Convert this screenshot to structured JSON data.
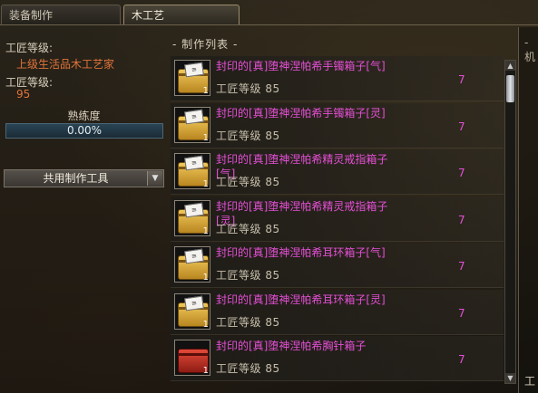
{
  "tabs": [
    {
      "label": "装备制作",
      "active": false
    },
    {
      "label": "木工艺",
      "active": true
    }
  ],
  "left": {
    "craft_level_label": "工匠等级:",
    "craft_title": "上级生活品木工艺家",
    "craft_level_label2": "工匠等级:",
    "craft_level_value": "95",
    "proficiency_label": "熟练度",
    "proficiency_text": "0.00%",
    "proficiency_value": 0,
    "tool_select": "共用制作工具"
  },
  "section": {
    "title": "- 制作列表 -",
    "right_title": "- 机"
  },
  "items": [
    {
      "name": "封印的[真]堕神涅帕希手镯箱子[气]",
      "level": "工匠等级 85",
      "count": "1",
      "qty": "7",
      "icon": "gold-box-icon"
    },
    {
      "name": "封印的[真]堕神涅帕希手镯箱子[灵]",
      "level": "工匠等级 85",
      "count": "1",
      "qty": "7",
      "icon": "gold-box-icon"
    },
    {
      "name": "封印的[真]堕神涅帕希精灵戒指箱子[气]",
      "level": "工匠等级 85",
      "count": "1",
      "qty": "7",
      "icon": "gold-box-icon"
    },
    {
      "name": "封印的[真]堕神涅帕希精灵戒指箱子[灵]",
      "level": "工匠等级 85",
      "count": "1",
      "qty": "7",
      "icon": "gold-box-icon"
    },
    {
      "name": "封印的[真]堕神涅帕希耳环箱子[气]",
      "level": "工匠等级 85",
      "count": "1",
      "qty": "7",
      "icon": "gold-box-icon"
    },
    {
      "name": "封印的[真]堕神涅帕希耳环箱子[灵]",
      "level": "工匠等级 85",
      "count": "1",
      "qty": "7",
      "icon": "gold-box-icon"
    },
    {
      "name": "封印的[真]堕神涅帕希胸针箱子",
      "level": "工匠等级 85",
      "count": "1",
      "qty": "7",
      "icon": "red-box-icon"
    }
  ],
  "right_panel": {
    "label": "工"
  }
}
